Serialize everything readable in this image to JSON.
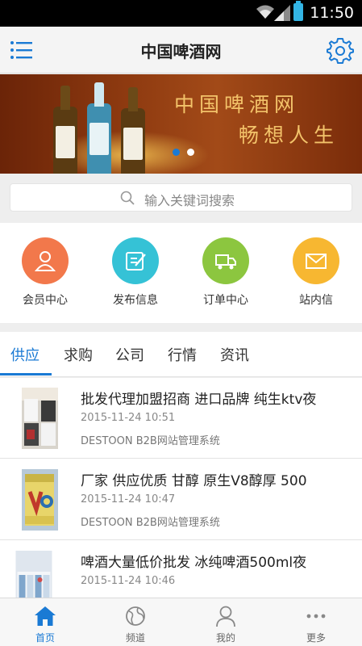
{
  "status_bar": {
    "time": "11:50"
  },
  "header": {
    "title": "中国啤酒网",
    "menu_icon": "menu-icon",
    "settings_icon": "gear-icon"
  },
  "banner": {
    "line1": "中国啤酒网",
    "line2": "畅想人生",
    "slides": 2,
    "active_slide": 1
  },
  "search": {
    "placeholder": "输入关键词搜索"
  },
  "quick_actions": [
    {
      "label": "会员中心",
      "icon": "user-icon",
      "color": "#f2784b"
    },
    {
      "label": "发布信息",
      "icon": "edit-icon",
      "color": "#35c2d6"
    },
    {
      "label": "订单中心",
      "icon": "truck-icon",
      "color": "#8cc63f"
    },
    {
      "label": "站内信",
      "icon": "mail-icon",
      "color": "#f7b731"
    }
  ],
  "tabs": [
    {
      "label": "供应",
      "active": true
    },
    {
      "label": "求购"
    },
    {
      "label": "公司"
    },
    {
      "label": "行情"
    },
    {
      "label": "资讯"
    }
  ],
  "list": [
    {
      "title": "批发代理加盟招商 进口品牌 纯生ktv夜",
      "date": "2015-11-24 10:51",
      "source": "DESTOON B2B网站管理系统"
    },
    {
      "title": "厂家 供应优质 甘醇 原生V8醇厚 500",
      "date": "2015-11-24 10:47",
      "source": "DESTOON B2B网站管理系统"
    },
    {
      "title": "啤酒大量低价批发 冰纯啤酒500ml夜",
      "date": "2015-11-24 10:46",
      "source": ""
    }
  ],
  "bottom_nav": [
    {
      "label": "首页",
      "icon": "home-icon",
      "active": true
    },
    {
      "label": "频道",
      "icon": "globe-icon"
    },
    {
      "label": "我的",
      "icon": "person-icon"
    },
    {
      "label": "更多",
      "icon": "more-icon"
    }
  ],
  "colors": {
    "accent": "#1a7ad4",
    "banner_text": "#f3c36a"
  }
}
